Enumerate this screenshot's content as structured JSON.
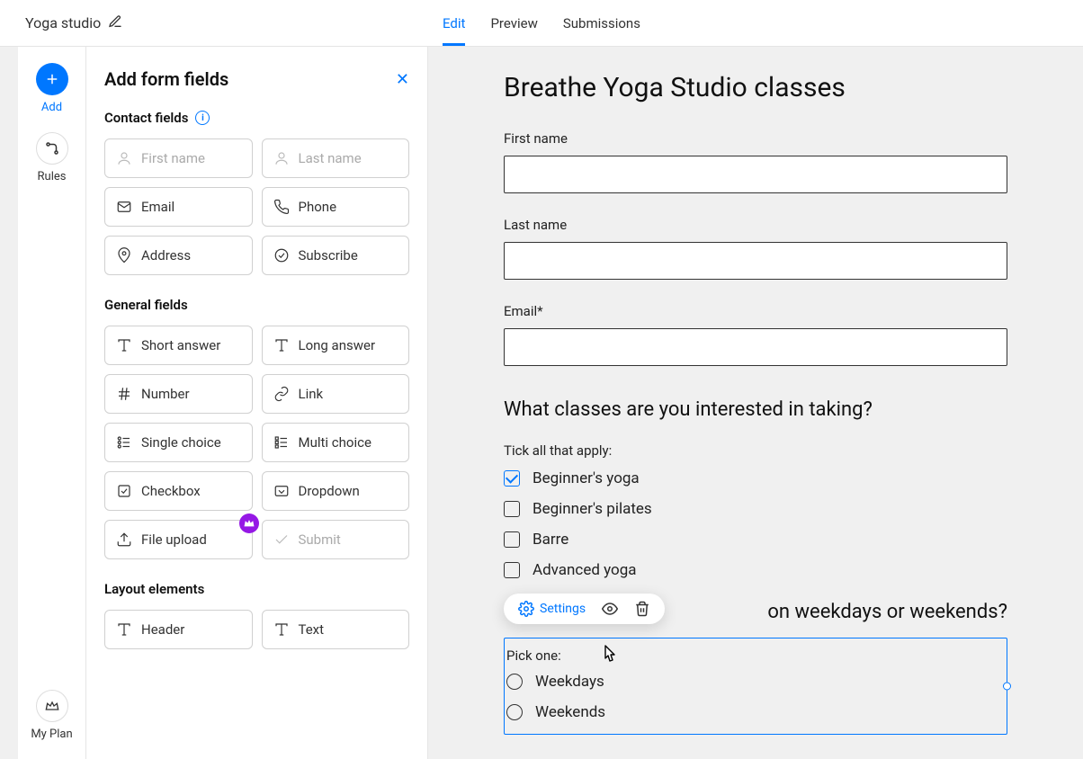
{
  "header": {
    "form_name": "Yoga studio",
    "tabs": [
      "Edit",
      "Preview",
      "Submissions"
    ],
    "active_tab": 0
  },
  "rail": {
    "add": "Add",
    "rules": "Rules",
    "my_plan": "My Plan"
  },
  "panel": {
    "title": "Add form fields",
    "sections": {
      "contact": "Contact fields",
      "general": "General fields",
      "layout": "Layout elements"
    },
    "contact_fields": [
      "First name",
      "Last name",
      "Email",
      "Phone",
      "Address",
      "Subscribe"
    ],
    "general_fields": [
      "Short answer",
      "Long answer",
      "Number",
      "Link",
      "Single choice",
      "Multi choice",
      "Checkbox",
      "Dropdown",
      "File upload",
      "Submit"
    ],
    "layout_fields": [
      "Header",
      "Text"
    ]
  },
  "form": {
    "title": "Breathe Yoga Studio classes",
    "fields": {
      "first_name": "First name",
      "last_name": "Last name",
      "email": "Email*"
    },
    "question1": {
      "heading": "What classes are you interested in taking?",
      "helper": "Tick all that apply:",
      "options": [
        "Beginner's yoga",
        "Beginner's pilates",
        "Barre",
        "Advanced yoga"
      ],
      "checked": [
        true,
        false,
        false,
        false
      ]
    },
    "question2": {
      "heading_partial": "on weekdays or weekends?",
      "helper": "Pick one:",
      "options": [
        "Weekdays",
        "Weekends"
      ]
    }
  },
  "toolbar": {
    "settings": "Settings"
  }
}
